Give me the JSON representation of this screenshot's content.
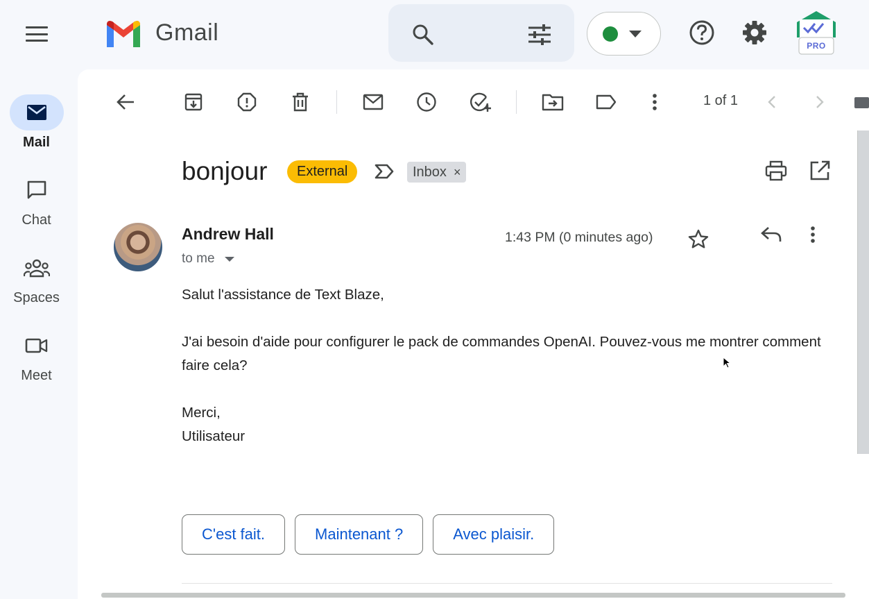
{
  "app": {
    "name": "Gmail"
  },
  "nav": {
    "items": [
      {
        "label": "Mail",
        "icon": "mail-icon",
        "active": true
      },
      {
        "label": "Chat",
        "icon": "chat-icon",
        "active": false
      },
      {
        "label": "Spaces",
        "icon": "spaces-icon",
        "active": false
      },
      {
        "label": "Meet",
        "icon": "meet-icon",
        "active": false
      }
    ]
  },
  "topbar": {
    "status_color": "#1e8e3e",
    "pro_badge": "PRO"
  },
  "toolbar": {
    "pager": "1 of 1"
  },
  "thread": {
    "subject": "bonjour",
    "external_label": "External",
    "inbox_chip": "Inbox",
    "inbox_remove": "×"
  },
  "message": {
    "sender": "Andrew Hall",
    "recipient": "to me",
    "time": "1:43 PM (0 minutes ago)",
    "body": [
      "Salut l'assistance de Text Blaze,",
      "",
      "J'ai besoin d'aide pour configurer le pack de commandes OpenAI. Pouvez-vous me montrer comment faire cela?",
      "",
      "Merci,",
      "Utilisateur"
    ]
  },
  "smart_replies": [
    "C'est fait.",
    "Maintenant ?",
    "Avec plaisir."
  ],
  "colors": {
    "accent": "#0b57d0",
    "external_badge": "#fbbc04",
    "active_nav": "#d3e3fd"
  }
}
